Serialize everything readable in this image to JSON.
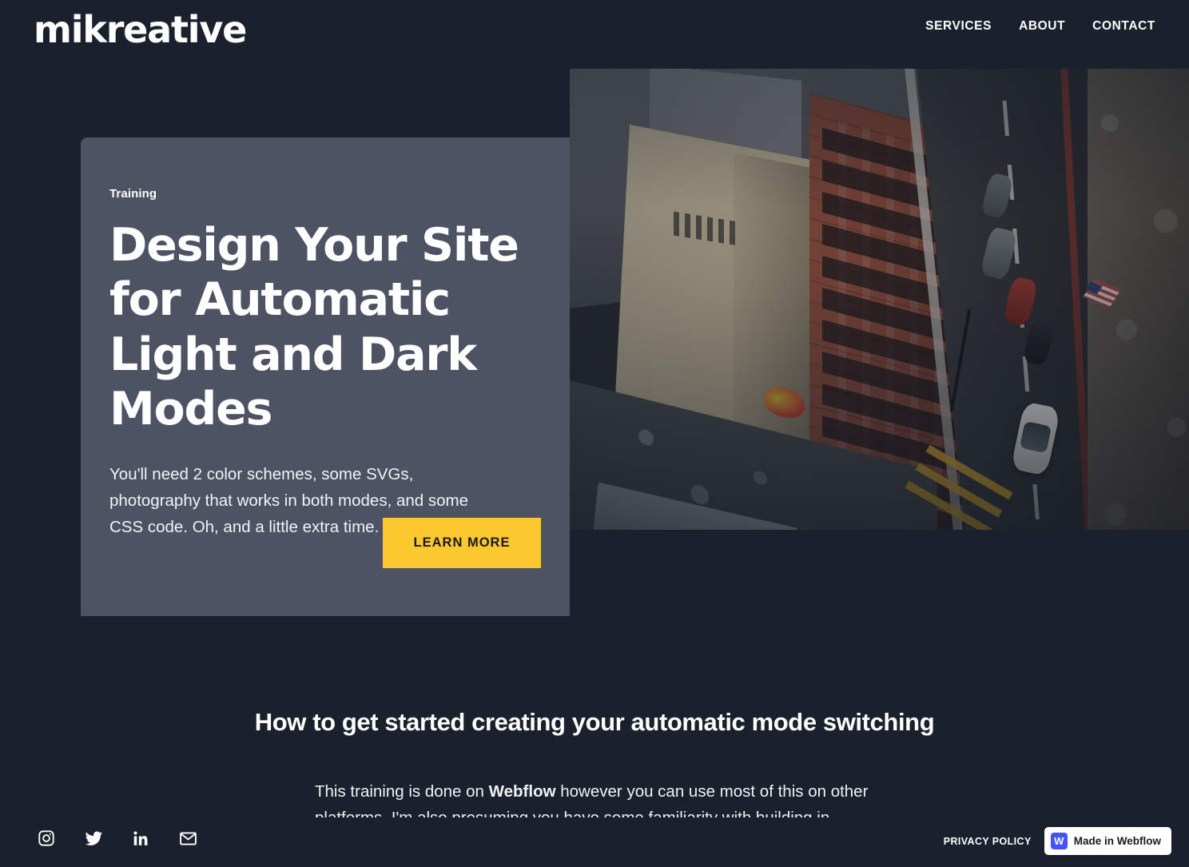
{
  "header": {
    "logo": "mikreative",
    "nav": [
      {
        "label": "SERVICES"
      },
      {
        "label": "ABOUT"
      },
      {
        "label": "CONTACT"
      }
    ]
  },
  "hero": {
    "eyebrow": "Training",
    "title": "Design Your Site for Automatic Light and Dark Modes",
    "subtitle": "You'll need 2 color schemes, some SVGs, photography that works in both modes, and some CSS code. Oh, and a little extra time.",
    "cta_label": "LEARN MORE",
    "cta_color": "#fbc82f",
    "card_color": "#4e5364",
    "photo_alt": "aerial view of a city street with brick buildings, parked cars and a white car driving"
  },
  "content": {
    "heading": "How to get started creating your automatic mode switching",
    "body_before": "This training is done on ",
    "body_bold": "Webflow",
    "body_after": " however you can use most of this on other platforms. I'm also presuming you have some familiarity with building in"
  },
  "footer": {
    "socials": [
      {
        "name": "instagram",
        "label": "Instagram"
      },
      {
        "name": "twitter",
        "label": "Twitter"
      },
      {
        "name": "linkedin",
        "label": "LinkedIn"
      },
      {
        "name": "email",
        "label": "Email"
      }
    ],
    "privacy_label": "PRIVACY POLICY",
    "badge_mark": "W",
    "badge_text": "Made in Webflow",
    "badge_mark_color": "#4353ff"
  },
  "theme": {
    "background": "#1b212c",
    "text": "#ffffff"
  }
}
